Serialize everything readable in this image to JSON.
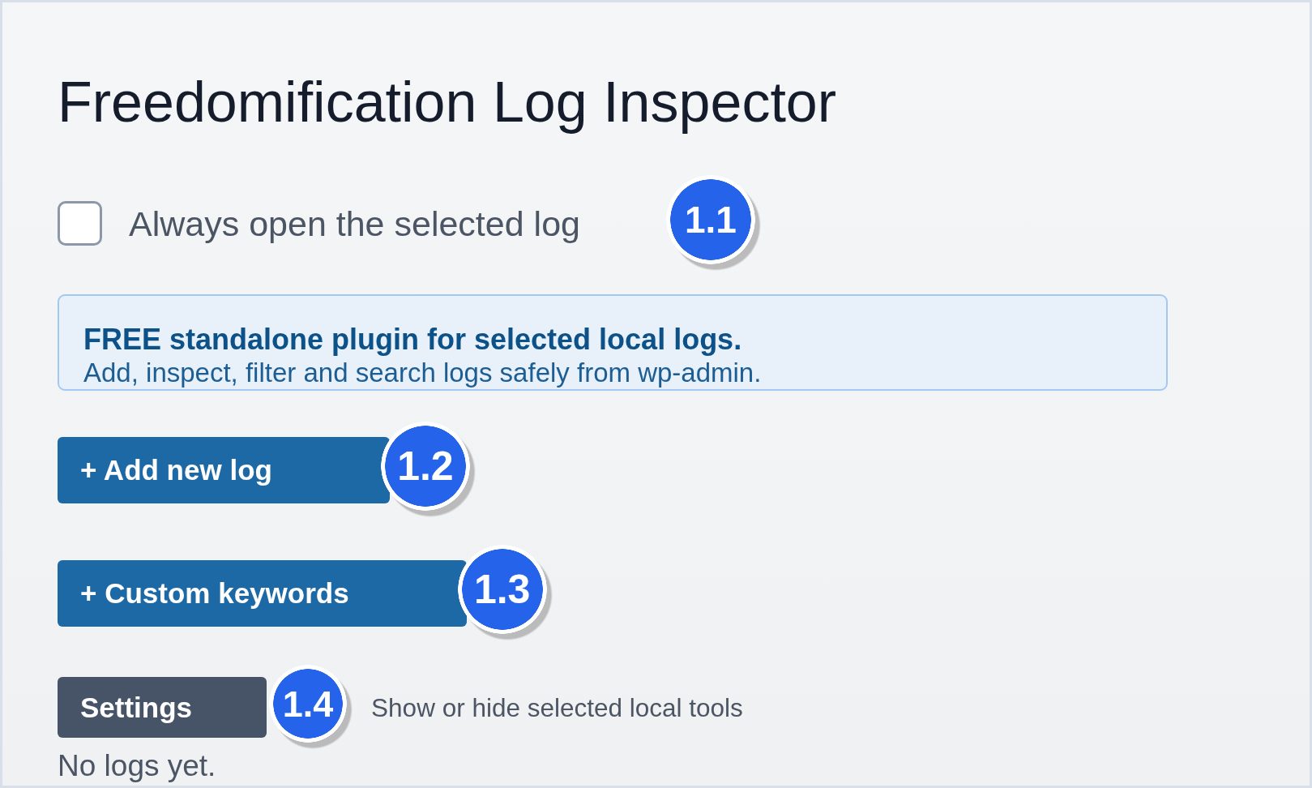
{
  "title": "Freedomification Log Inspector",
  "option": {
    "label": "Always open the selected log",
    "checked": false,
    "marker": "1.1"
  },
  "notice": {
    "heading": "FREE standalone plugin for selected local logs.",
    "text": "Add, inspect, filter and search logs safely from wp-admin."
  },
  "actions": [
    {
      "kind": "primary",
      "label": "+ Add new log",
      "marker": "1.2"
    },
    {
      "kind": "primary",
      "label": "+ Custom keywords",
      "marker": "1.3"
    },
    {
      "kind": "secondary",
      "label": "Settings",
      "marker": "1.4",
      "hint": "Show or hide selected local tools"
    }
  ],
  "empty_message": "No logs yet."
}
